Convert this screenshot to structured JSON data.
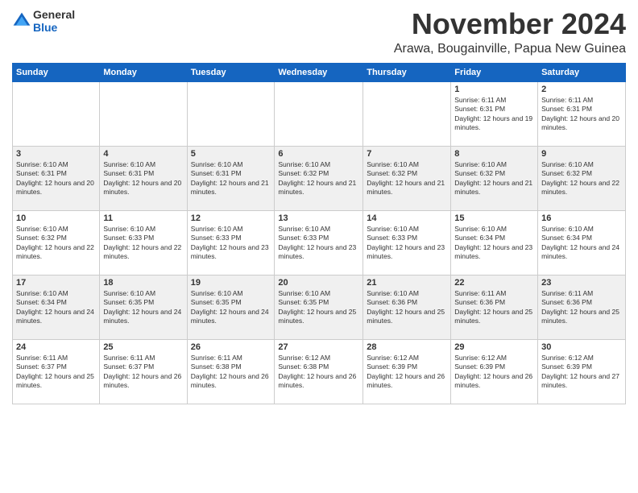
{
  "logo": {
    "general": "General",
    "blue": "Blue"
  },
  "title": "November 2024",
  "location": "Arawa, Bougainville, Papua New Guinea",
  "days_of_week": [
    "Sunday",
    "Monday",
    "Tuesday",
    "Wednesday",
    "Thursday",
    "Friday",
    "Saturday"
  ],
  "weeks": [
    [
      {
        "day": "",
        "info": ""
      },
      {
        "day": "",
        "info": ""
      },
      {
        "day": "",
        "info": ""
      },
      {
        "day": "",
        "info": ""
      },
      {
        "day": "",
        "info": ""
      },
      {
        "day": "1",
        "info": "Sunrise: 6:11 AM\nSunset: 6:31 PM\nDaylight: 12 hours and 19 minutes."
      },
      {
        "day": "2",
        "info": "Sunrise: 6:11 AM\nSunset: 6:31 PM\nDaylight: 12 hours and 20 minutes."
      }
    ],
    [
      {
        "day": "3",
        "info": "Sunrise: 6:10 AM\nSunset: 6:31 PM\nDaylight: 12 hours and 20 minutes."
      },
      {
        "day": "4",
        "info": "Sunrise: 6:10 AM\nSunset: 6:31 PM\nDaylight: 12 hours and 20 minutes."
      },
      {
        "day": "5",
        "info": "Sunrise: 6:10 AM\nSunset: 6:31 PM\nDaylight: 12 hours and 21 minutes."
      },
      {
        "day": "6",
        "info": "Sunrise: 6:10 AM\nSunset: 6:32 PM\nDaylight: 12 hours and 21 minutes."
      },
      {
        "day": "7",
        "info": "Sunrise: 6:10 AM\nSunset: 6:32 PM\nDaylight: 12 hours and 21 minutes."
      },
      {
        "day": "8",
        "info": "Sunrise: 6:10 AM\nSunset: 6:32 PM\nDaylight: 12 hours and 21 minutes."
      },
      {
        "day": "9",
        "info": "Sunrise: 6:10 AM\nSunset: 6:32 PM\nDaylight: 12 hours and 22 minutes."
      }
    ],
    [
      {
        "day": "10",
        "info": "Sunrise: 6:10 AM\nSunset: 6:32 PM\nDaylight: 12 hours and 22 minutes."
      },
      {
        "day": "11",
        "info": "Sunrise: 6:10 AM\nSunset: 6:33 PM\nDaylight: 12 hours and 22 minutes."
      },
      {
        "day": "12",
        "info": "Sunrise: 6:10 AM\nSunset: 6:33 PM\nDaylight: 12 hours and 23 minutes."
      },
      {
        "day": "13",
        "info": "Sunrise: 6:10 AM\nSunset: 6:33 PM\nDaylight: 12 hours and 23 minutes."
      },
      {
        "day": "14",
        "info": "Sunrise: 6:10 AM\nSunset: 6:33 PM\nDaylight: 12 hours and 23 minutes."
      },
      {
        "day": "15",
        "info": "Sunrise: 6:10 AM\nSunset: 6:34 PM\nDaylight: 12 hours and 23 minutes."
      },
      {
        "day": "16",
        "info": "Sunrise: 6:10 AM\nSunset: 6:34 PM\nDaylight: 12 hours and 24 minutes."
      }
    ],
    [
      {
        "day": "17",
        "info": "Sunrise: 6:10 AM\nSunset: 6:34 PM\nDaylight: 12 hours and 24 minutes."
      },
      {
        "day": "18",
        "info": "Sunrise: 6:10 AM\nSunset: 6:35 PM\nDaylight: 12 hours and 24 minutes."
      },
      {
        "day": "19",
        "info": "Sunrise: 6:10 AM\nSunset: 6:35 PM\nDaylight: 12 hours and 24 minutes."
      },
      {
        "day": "20",
        "info": "Sunrise: 6:10 AM\nSunset: 6:35 PM\nDaylight: 12 hours and 25 minutes."
      },
      {
        "day": "21",
        "info": "Sunrise: 6:10 AM\nSunset: 6:36 PM\nDaylight: 12 hours and 25 minutes."
      },
      {
        "day": "22",
        "info": "Sunrise: 6:11 AM\nSunset: 6:36 PM\nDaylight: 12 hours and 25 minutes."
      },
      {
        "day": "23",
        "info": "Sunrise: 6:11 AM\nSunset: 6:36 PM\nDaylight: 12 hours and 25 minutes."
      }
    ],
    [
      {
        "day": "24",
        "info": "Sunrise: 6:11 AM\nSunset: 6:37 PM\nDaylight: 12 hours and 25 minutes."
      },
      {
        "day": "25",
        "info": "Sunrise: 6:11 AM\nSunset: 6:37 PM\nDaylight: 12 hours and 26 minutes."
      },
      {
        "day": "26",
        "info": "Sunrise: 6:11 AM\nSunset: 6:38 PM\nDaylight: 12 hours and 26 minutes."
      },
      {
        "day": "27",
        "info": "Sunrise: 6:12 AM\nSunset: 6:38 PM\nDaylight: 12 hours and 26 minutes."
      },
      {
        "day": "28",
        "info": "Sunrise: 6:12 AM\nSunset: 6:39 PM\nDaylight: 12 hours and 26 minutes."
      },
      {
        "day": "29",
        "info": "Sunrise: 6:12 AM\nSunset: 6:39 PM\nDaylight: 12 hours and 26 minutes."
      },
      {
        "day": "30",
        "info": "Sunrise: 6:12 AM\nSunset: 6:39 PM\nDaylight: 12 hours and 27 minutes."
      }
    ]
  ]
}
